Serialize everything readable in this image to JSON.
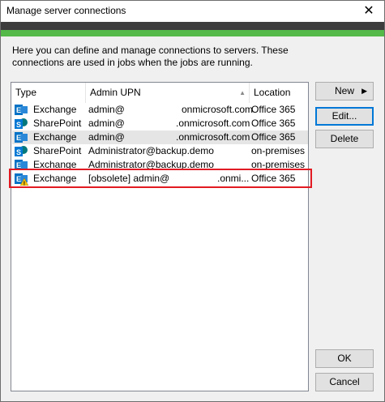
{
  "window": {
    "title": "Manage server connections",
    "close_glyph": "✕"
  },
  "description": "Here you can define and manage connections to servers. These connections are used in jobs when the jobs are running.",
  "table": {
    "columns": [
      "Type",
      "Admin UPN",
      "Location"
    ],
    "sort_indicator": "▲",
    "rows": [
      {
        "type": "Exchange",
        "icon": "exchange-icon",
        "upn": "admin@",
        "domain": "onmicrosoft.com",
        "location": "Office 365"
      },
      {
        "type": "SharePoint",
        "icon": "sharepoint-icon",
        "upn": "admin@",
        "domain": ".onmicrosoft.com",
        "location": "Office 365"
      },
      {
        "type": "Exchange",
        "icon": "exchange-icon",
        "upn": "admin@",
        "domain": ".onmicrosoft.com",
        "location": "Office 365"
      },
      {
        "type": "SharePoint",
        "icon": "sharepoint-icon",
        "upn": "Administrator@backup.demo",
        "domain": "",
        "location": "on-premises"
      },
      {
        "type": "Exchange",
        "icon": "exchange-icon",
        "upn": "Administrator@backup.demo",
        "domain": "",
        "location": "on-premises"
      },
      {
        "type": "Exchange",
        "icon": "exchange-warning-icon",
        "upn": "[obsolete] admin@",
        "domain": ".onmi...",
        "location": "Office 365"
      }
    ]
  },
  "buttons": {
    "new": "New",
    "new_arrow": "▶",
    "edit": "Edit...",
    "delete": "Delete",
    "ok": "OK",
    "cancel": "Cancel"
  },
  "colors": {
    "accent_green": "#54b948",
    "band_dark": "#3d3d3d",
    "highlight_red": "#e21b23",
    "exchange_blue": "#0072c6",
    "sharepoint_blue": "#0078d4"
  }
}
